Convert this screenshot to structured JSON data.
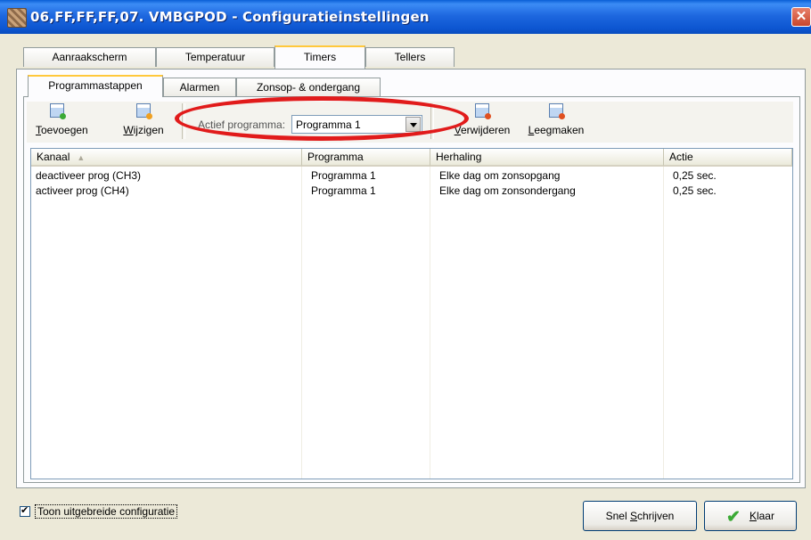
{
  "window": {
    "title": "06,FF,FF,FF,07. VMBGPOD - Configuratieinstellingen"
  },
  "outer_tabs": [
    {
      "label": "Aanraakscherm"
    },
    {
      "label": "Temperatuur"
    },
    {
      "label": "Timers"
    },
    {
      "label": "Tellers"
    }
  ],
  "inner_tabs": [
    {
      "label": "Programmastappen"
    },
    {
      "label": "Alarmen"
    },
    {
      "label": "Zonsop- & ondergang"
    }
  ],
  "toolbar": {
    "add": {
      "mnemonic": "T",
      "rest": "oevoegen"
    },
    "edit": {
      "mnemonic": "W",
      "rest": "ijzigen"
    },
    "active_program_label": "Actief programma:",
    "active_program_value": "Programma 1",
    "delete": {
      "mnemonic": "V",
      "rest": "erwijderen"
    },
    "clear": {
      "mnemonic": "L",
      "rest": "eegmaken"
    }
  },
  "table": {
    "columns": [
      "Kanaal",
      "Programma",
      "Herhaling",
      "Actie"
    ],
    "rows": [
      [
        "deactiveer prog (CH3)",
        "Programma 1",
        "Elke dag om zonsopgang",
        "0,25 sec."
      ],
      [
        "activeer prog (CH4)",
        "Programma 1",
        "Elke dag om zonsondergang",
        "0,25 sec."
      ]
    ]
  },
  "footer": {
    "show_advanced_label": "Toon uitgebreide configuratie",
    "show_advanced_checked": true,
    "quick_write": {
      "before": "Snel ",
      "mnemonic": "S",
      "after": "chrijven"
    },
    "done": {
      "mnemonic": "K",
      "rest": "laar"
    }
  },
  "colors": {
    "highlight": "#E11B1B",
    "titlebar": "#0C55D0",
    "dialog_bg": "#ECE9D8"
  }
}
